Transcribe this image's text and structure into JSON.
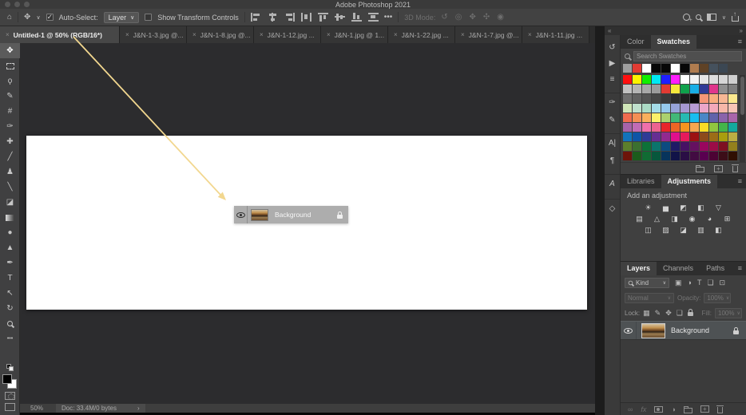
{
  "window": {
    "title": "Adobe Photoshop 2021"
  },
  "icons": {
    "home": "⌂",
    "close": "×",
    "chevron_down": "∨",
    "more": "•••",
    "move": "✥",
    "collapse_left": "«",
    "collapse_right": "»",
    "menu": "≡",
    "status_chevron": "›"
  },
  "options_bar": {
    "auto_select_label": "Auto-Select:",
    "auto_select_value": "Layer",
    "show_transform_label": "Show Transform Controls",
    "mode_label": "3D Mode:",
    "align_icons": [
      {
        "name": "align-left-edges-icon",
        "cls": "al-left"
      },
      {
        "name": "align-horizontal-centers-icon",
        "cls": "al-hcenter"
      },
      {
        "name": "align-right-edges-icon",
        "cls": "al-right"
      },
      {
        "name": "distribute-horizontal-icon",
        "cls": "al-disth"
      },
      {
        "name": "align-top-edges-icon",
        "cls": "al-top"
      },
      {
        "name": "align-vertical-centers-icon",
        "cls": "al-vcenter"
      },
      {
        "name": "align-bottom-edges-icon",
        "cls": "al-bottom"
      },
      {
        "name": "distribute-vertical-icon",
        "cls": "al-distv"
      }
    ],
    "mode_icons": [
      {
        "name": "3d-orbit-icon",
        "glyph": "↺"
      },
      {
        "name": "3d-roll-icon",
        "glyph": "◎"
      },
      {
        "name": "3d-pan-icon",
        "glyph": "✥"
      },
      {
        "name": "3d-slide-icon",
        "glyph": "✣"
      },
      {
        "name": "3d-camera-icon",
        "glyph": "◉"
      }
    ]
  },
  "tabs": [
    {
      "label": "Untitled-1 @ 50% (RGB/16*)",
      "active": true
    },
    {
      "label": "J&N-1-3.jpg @...",
      "active": false
    },
    {
      "label": "J&N-1-8.jpg @...",
      "active": false
    },
    {
      "label": "J&N-1-12.jpg ...",
      "active": false
    },
    {
      "label": "J&N-1.jpg @ 1...",
      "active": false
    },
    {
      "label": "J&N-1-22.jpg ...",
      "active": false
    },
    {
      "label": "J&N-1-7.jpg @...",
      "active": false
    },
    {
      "label": "J&N-1-11.jpg ...",
      "active": false
    }
  ],
  "toolbar": {
    "tools": [
      {
        "name": "move-tool",
        "glyph": "✥",
        "selected": true
      },
      {
        "name": "marquee-tool",
        "type": "marquee"
      },
      {
        "name": "lasso-tool",
        "glyph": "ϙ"
      },
      {
        "name": "quick-selection-tool",
        "glyph": "✎"
      },
      {
        "name": "crop-tool",
        "glyph": "#"
      },
      {
        "name": "eyedropper-tool",
        "glyph": "✑"
      },
      {
        "name": "spot-healing-tool",
        "glyph": "✚"
      },
      {
        "name": "brush-tool",
        "glyph": "╱"
      },
      {
        "name": "clone-stamp-tool",
        "glyph": "♟"
      },
      {
        "name": "history-brush-tool",
        "glyph": "╲"
      },
      {
        "name": "eraser-tool",
        "glyph": "◪"
      },
      {
        "name": "gradient-tool",
        "type": "gradient"
      },
      {
        "name": "blur-tool",
        "glyph": "●"
      },
      {
        "name": "dodge-tool",
        "glyph": "▲"
      },
      {
        "name": "pen-tool",
        "glyph": "✒"
      },
      {
        "name": "type-tool",
        "glyph": "T"
      },
      {
        "name": "path-selection-tool",
        "glyph": "↖"
      },
      {
        "name": "rotate-view-tool",
        "glyph": "↻"
      },
      {
        "name": "zoom-tool",
        "type": "zoom"
      },
      {
        "name": "edit-toolbar-button",
        "glyph": "•••"
      }
    ]
  },
  "canvas": {
    "drag_layer": {
      "name": "Background"
    }
  },
  "status_bar": {
    "zoom_level": "50%",
    "doc_info": "Doc: 33.4M/0 bytes"
  },
  "dock_icons": [
    {
      "name": "history-panel-icon",
      "glyph": "↺",
      "gap": false
    },
    {
      "name": "actions-panel-icon",
      "glyph": "▶",
      "gap": false
    },
    {
      "name": "properties-panel-icon",
      "glyph": "≡",
      "gap": false
    },
    {
      "name": "brush-settings-panel-icon",
      "glyph": "✑",
      "gap": true
    },
    {
      "name": "brushes-panel-icon",
      "glyph": "✎",
      "gap": false
    },
    {
      "name": "character-panel-icon",
      "glyph": "A|",
      "gap": true
    },
    {
      "name": "paragraph-panel-icon",
      "glyph": "¶",
      "gap": false
    },
    {
      "name": "glyphs-panel-icon",
      "glyph": "A",
      "italic": true,
      "gap": true
    },
    {
      "name": "3d-panel-icon",
      "glyph": "◇",
      "gap": true
    }
  ],
  "panels": {
    "swatches": {
      "tabs": [
        "Color",
        "Swatches"
      ],
      "active_tab": "Swatches",
      "search_placeholder": "Search Swatches",
      "recent": [
        "#9e9e9e",
        "#e23b33",
        "#ffffff",
        "#070707",
        "#070707",
        "#ffffff",
        "#070707",
        "#b07c4f",
        "#5f4226",
        "#45515d",
        "#3b4753"
      ],
      "grid_rows": [
        [
          "#ff0f0f",
          "#fdf300",
          "#12ee00",
          "#00e9f2",
          "#1f1fff",
          "#ff1fff",
          "#ffffff",
          "#f2f2f2",
          "#e6e6e6",
          "#dedede",
          "#d6d6d6",
          "#cfcfcf"
        ],
        [
          "#c2c2c2",
          "#b5b5b5",
          "#a8a8a8",
          "#9c9c9c",
          "#e23b33",
          "#f6e93c",
          "#0fa24b",
          "#18aee5",
          "#303a96",
          "#e0368c",
          "#8f8f8f",
          "#7f7f7f"
        ],
        [
          "#6f6f6f",
          "#616161",
          "#545454",
          "#474747",
          "#3a3a3a",
          "#2d2d2d",
          "#1f1f1f",
          "#070707",
          "#f59678",
          "#f8ad7f",
          "#f7b794",
          "#fbe88e"
        ],
        [
          "#cfe5b8",
          "#bfe0cc",
          "#abdbc5",
          "#a4dce8",
          "#95c9ec",
          "#96a3d8",
          "#a698d2",
          "#b79bd4",
          "#eba6c9",
          "#f3a9bb",
          "#f6b7a9",
          "#f7c4b6"
        ],
        [
          "#ef6c4e",
          "#f48f55",
          "#f9af5d",
          "#fbf06a",
          "#abd16e",
          "#42b878",
          "#26bab2",
          "#18bdf0",
          "#4b87c7",
          "#6163aa",
          "#8a63ab",
          "#a965aa"
        ],
        [
          "#a763a9",
          "#c16cb6",
          "#ef70ab",
          "#ec6390",
          "#e8242b",
          "#ef6525",
          "#f5941f",
          "#f7a64f",
          "#fbdc26",
          "#90c63f",
          "#43b54a",
          "#14a99d"
        ],
        [
          "#1173bc",
          "#0e55a7",
          "#303b96",
          "#672e92",
          "#92298f",
          "#e0108c",
          "#e61a5c",
          "#9c1013",
          "#8d4a1b",
          "#9c6d17",
          "#a89e0e",
          "#bcae43"
        ],
        [
          "#5c7e2c",
          "#3b7030",
          "#0d7238",
          "#0b746c",
          "#0c4b80",
          "#1f1a66",
          "#471264",
          "#651060",
          "#99065e",
          "#9c0c47",
          "#7e1021",
          "#93801d"
        ],
        [
          "#6d1409",
          "#1c5c1c",
          "#116b33",
          "#07573c",
          "#07345c",
          "#111348",
          "#2a0e45",
          "#420c42",
          "#590050",
          "#4c0334",
          "#3c0d18",
          "#301003"
        ]
      ]
    },
    "adjustments": {
      "tabs": [
        "Libraries",
        "Adjustments"
      ],
      "active_tab": "Adjustments",
      "header": "Add an adjustment",
      "rows": [
        [
          {
            "name": "brightness-contrast",
            "glyph": "☀"
          },
          {
            "name": "levels",
            "glyph": "▅"
          },
          {
            "name": "curves",
            "glyph": "◩"
          },
          {
            "name": "exposure",
            "glyph": "◧"
          },
          {
            "name": "vibrance",
            "glyph": "▽"
          }
        ],
        [
          {
            "name": "hue-saturation",
            "glyph": "▤"
          },
          {
            "name": "color-balance",
            "glyph": "△"
          },
          {
            "name": "black-white",
            "glyph": "◨"
          },
          {
            "name": "photo-filter",
            "glyph": "◉"
          },
          {
            "name": "channel-mixer",
            "glyph": "◕"
          },
          {
            "name": "color-lookup",
            "glyph": "⊞"
          }
        ],
        [
          {
            "name": "invert",
            "glyph": "◫"
          },
          {
            "name": "posterize",
            "glyph": "▨"
          },
          {
            "name": "threshold",
            "glyph": "◪"
          },
          {
            "name": "gradient-map",
            "glyph": "▥"
          },
          {
            "name": "selective-color",
            "glyph": "◧"
          }
        ]
      ]
    },
    "layers": {
      "tabs": [
        "Layers",
        "Channels",
        "Paths"
      ],
      "active_tab": "Layers",
      "filter_value": "Kind",
      "filter_icons": [
        {
          "name": "filter-pixel-layers-icon",
          "glyph": "▣"
        },
        {
          "name": "filter-adjustment-layers-icon",
          "glyph": "◑"
        },
        {
          "name": "filter-type-layers-icon",
          "glyph": "T"
        },
        {
          "name": "filter-shape-layers-icon",
          "glyph": "❏"
        },
        {
          "name": "filter-smart-objects-icon",
          "glyph": "⊡"
        }
      ],
      "blend_mode": "Normal",
      "opacity_label": "Opacity:",
      "opacity_value": "100%",
      "lock_label": "Lock:",
      "lock_icons": [
        {
          "name": "lock-transparent-pixels-icon",
          "glyph": "▦"
        },
        {
          "name": "lock-image-pixels-icon",
          "glyph": "✎"
        },
        {
          "name": "lock-position-icon",
          "glyph": "✥"
        },
        {
          "name": "lock-artboard-icon",
          "glyph": "❏"
        },
        {
          "name": "lock-all-icon",
          "type": "lock"
        }
      ],
      "fill_label": "Fill:",
      "fill_value": "100%",
      "rows": [
        {
          "name": "Background",
          "visible": true,
          "locked": true,
          "selected": true
        }
      ],
      "bottom_icons": [
        {
          "name": "link-layers-button",
          "glyph": "∞",
          "dim": true
        },
        {
          "name": "layer-effects-button",
          "glyph": "fx",
          "dim": true,
          "italic": true
        },
        {
          "name": "add-layer-mask-button",
          "type": "mask"
        },
        {
          "name": "new-adjustment-layer-button",
          "glyph": "◑"
        },
        {
          "name": "new-group-button",
          "type": "folder"
        },
        {
          "name": "new-layer-button",
          "type": "plusbox"
        },
        {
          "name": "delete-layer-button",
          "type": "trash"
        }
      ]
    },
    "swatches_bottom_icons": [
      {
        "name": "new-swatch-group-button",
        "type": "folder"
      },
      {
        "name": "new-swatch-button",
        "type": "plusbox"
      },
      {
        "name": "delete-swatch-button",
        "type": "trash"
      }
    ]
  },
  "annotation": {
    "arrow_color": "#f2d78f"
  }
}
